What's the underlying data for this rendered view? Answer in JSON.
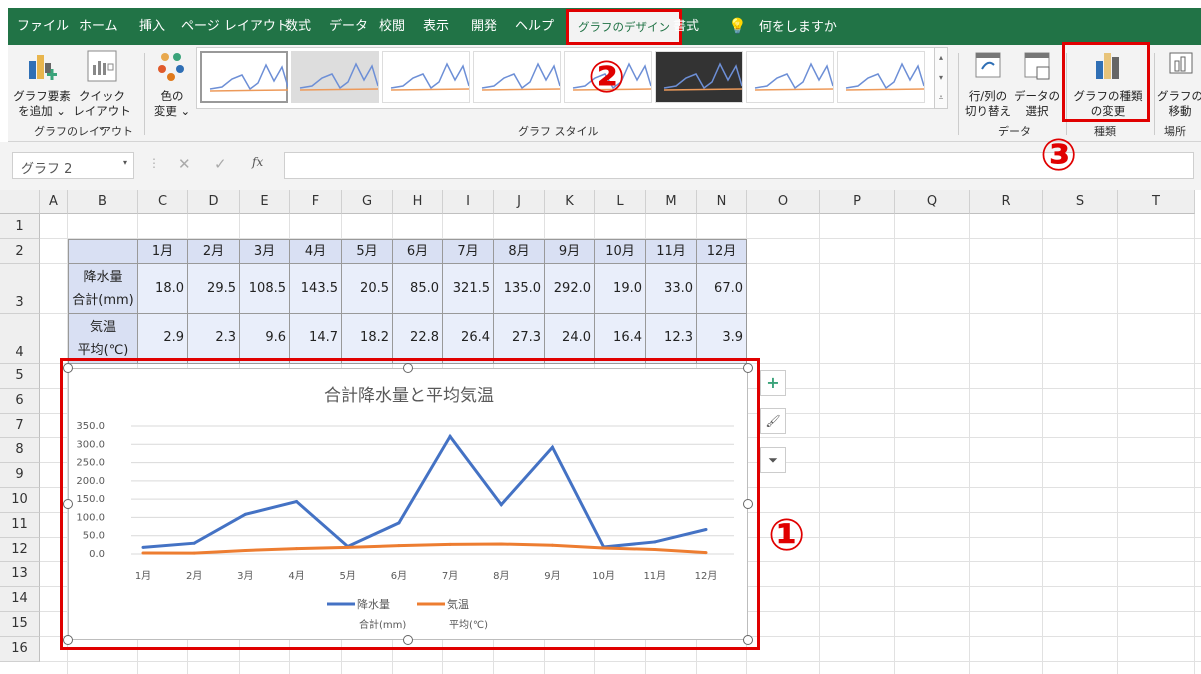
{
  "tabs": [
    "ファイル",
    "ホーム",
    "挿入",
    "ページ レイアウト",
    "数式",
    "データ",
    "校閲",
    "表示",
    "開発",
    "ヘルプ",
    "グラフのデザイン",
    "書式"
  ],
  "tell_me": "何をしますか",
  "ribbon": {
    "add_element": [
      "グラフ要素",
      "を追加 ⌄"
    ],
    "quick_layout": [
      "クイック",
      "レイアウト ⌄"
    ],
    "layout_group": "グラフのレイアウト",
    "change_colors": [
      "色の",
      "変更 ⌄"
    ],
    "styles_group": "グラフ スタイル",
    "switch_row_col": [
      "行/列の",
      "切り替え"
    ],
    "select_data": [
      "データの",
      "選択"
    ],
    "data_group": "データ",
    "change_type": [
      "グラフの種類",
      "の変更"
    ],
    "type_group": "種類",
    "move_chart": [
      "グラフの",
      "移動"
    ],
    "location_group": "場所"
  },
  "name_box": "グラフ 2",
  "fx": "fx",
  "columns": [
    "A",
    "B",
    "C",
    "D",
    "E",
    "F",
    "G",
    "H",
    "I",
    "J",
    "K",
    "L",
    "M",
    "N",
    "O",
    "P",
    "Q",
    "R",
    "S",
    "T"
  ],
  "rows": [
    "1",
    "2",
    "3",
    "4",
    "5",
    "6",
    "7",
    "8",
    "9",
    "10",
    "11",
    "12",
    "13",
    "14",
    "15",
    "16"
  ],
  "table": {
    "months": [
      "1月",
      "2月",
      "3月",
      "4月",
      "5月",
      "6月",
      "7月",
      "8月",
      "9月",
      "10月",
      "11月",
      "12月"
    ],
    "row_labels": [
      [
        "降水量",
        "合計(mm)"
      ],
      [
        "気温",
        "平均(℃)"
      ]
    ],
    "rain": [
      "18.0",
      "29.5",
      "108.5",
      "143.5",
      "20.5",
      "85.0",
      "321.5",
      "135.0",
      "292.0",
      "19.0",
      "33.0",
      "67.0"
    ],
    "temp": [
      "2.9",
      "2.3",
      "9.6",
      "14.7",
      "18.2",
      "22.8",
      "26.4",
      "27.3",
      "24.0",
      "16.4",
      "12.3",
      "3.9"
    ]
  },
  "chart_data": {
    "type": "line",
    "title": "合計降水量と平均気温",
    "categories": [
      "1月",
      "2月",
      "3月",
      "4月",
      "5月",
      "6月",
      "7月",
      "8月",
      "9月",
      "10月",
      "11月",
      "12月"
    ],
    "ylim": [
      0,
      350
    ],
    "yticks": [
      "0.0",
      "50.0",
      "100.0",
      "150.0",
      "200.0",
      "250.0",
      "300.0",
      "350.0"
    ],
    "grid": true,
    "legend": "bottom",
    "series": [
      {
        "name": "降水量 合計(mm)",
        "legend": [
          "降水量",
          "合計(mm)"
        ],
        "color": "#4472c4",
        "values": [
          18.0,
          29.5,
          108.5,
          143.5,
          20.5,
          85.0,
          321.5,
          135.0,
          292.0,
          19.0,
          33.0,
          67.0
        ]
      },
      {
        "name": "気温 平均(℃)",
        "legend": [
          "気温",
          "平均(℃)"
        ],
        "color": "#ed7d31",
        "values": [
          2.9,
          2.3,
          9.6,
          14.7,
          18.2,
          22.8,
          26.4,
          27.3,
          24.0,
          16.4,
          12.3,
          3.9
        ]
      }
    ]
  },
  "annotations": [
    "①",
    "②",
    "③"
  ],
  "colors": {
    "excel_green": "#217346",
    "highlight": "#e00000"
  }
}
